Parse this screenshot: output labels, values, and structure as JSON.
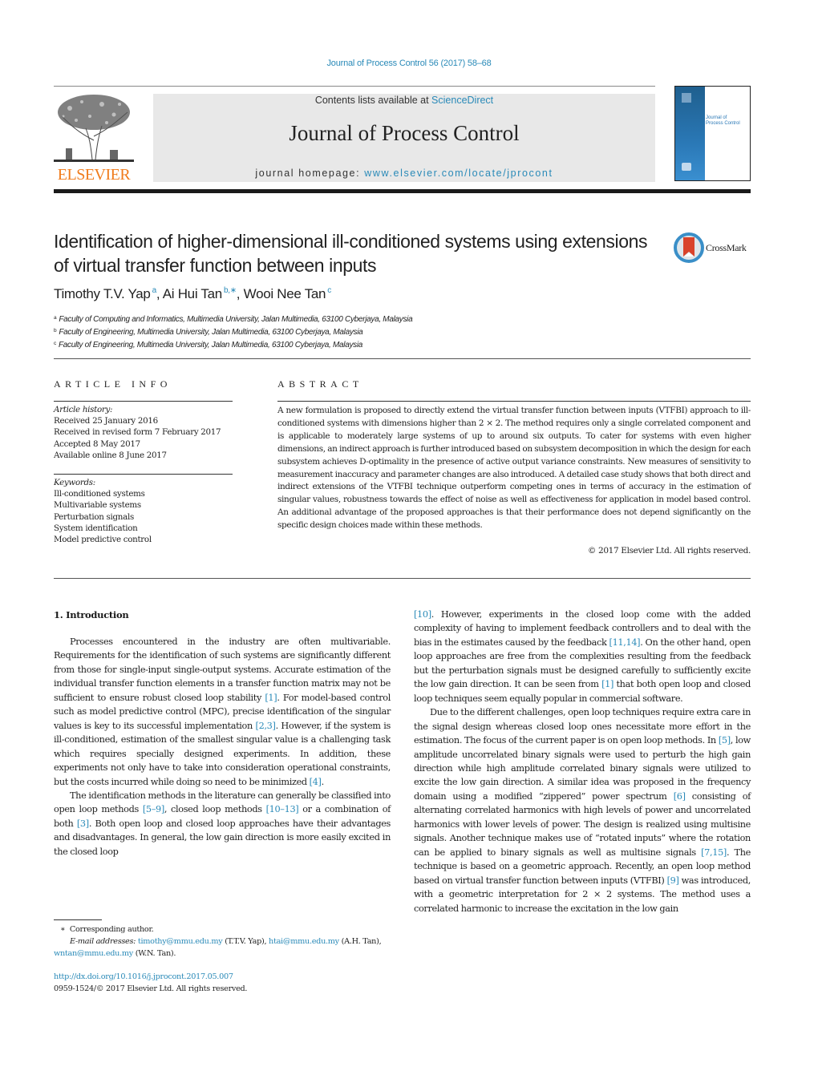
{
  "header": {
    "journal_ref": "Journal of Process Control 56 (2017) 58–68",
    "contents_prefix": "Contents lists available at ",
    "contents_link": "ScienceDirect",
    "journal_title": "Journal of Process Control",
    "homepage_prefix": "journal homepage: ",
    "homepage_link": "www.elsevier.com/locate/jprocont",
    "publisher_logo_text": "ELSEVIER",
    "cover_title_line1": "Journal of",
    "cover_title_line2": "Process Control",
    "colors": {
      "link": "#2a8ab8",
      "elsevier_orange": "#f07c1c",
      "masthead_bg": "#e8e8e8"
    }
  },
  "article": {
    "title": "Identification of higher-dimensional ill-conditioned systems using extensions of virtual transfer function between inputs",
    "crossmark_label": "CrossMark",
    "authors": [
      {
        "name": "Timothy T.V. Yap",
        "sup": "a",
        "sep": ", "
      },
      {
        "name": "Ai Hui Tan",
        "sup": "b,∗",
        "sep": ", "
      },
      {
        "name": "Wooi Nee Tan",
        "sup": "c",
        "sep": ""
      }
    ],
    "affiliations": [
      {
        "key": "a",
        "text": "Faculty of Computing and Informatics, Multimedia University, Jalan Multimedia, 63100 Cyberjaya, Malaysia"
      },
      {
        "key": "b",
        "text": "Faculty of Engineering, Multimedia University, Jalan Multimedia, 63100 Cyberjaya, Malaysia"
      },
      {
        "key": "c",
        "text": "Faculty of Engineering, Multimedia University, Jalan Multimedia, 63100 Cyberjaya, Malaysia"
      }
    ]
  },
  "article_info": {
    "label": "ARTICLE INFO",
    "history_heading": "Article history:",
    "history": [
      "Received 25 January 2016",
      "Received in revised form 7 February 2017",
      "Accepted 8 May 2017",
      "Available online 8 June 2017"
    ],
    "keywords_heading": "Keywords:",
    "keywords": [
      "Ill-conditioned systems",
      "Multivariable systems",
      "Perturbation signals",
      "System identification",
      "Model predictive control"
    ]
  },
  "abstract": {
    "label": "ABSTRACT",
    "text": "A new formulation is proposed to directly extend the virtual transfer function between inputs (VTFBI) approach to ill-conditioned systems with dimensions higher than 2 × 2. The method requires only a single correlated component and is applicable to moderately large systems of up to around six outputs. To cater for systems with even higher dimensions, an indirect approach is further introduced based on subsystem decomposition in which the design for each subsystem achieves D-optimality in the presence of active output variance constraints. New measures of sensitivity to measurement inaccuracy and parameter changes are also introduced. A detailed case study shows that both direct and indirect extensions of the VTFBI technique outperform competing ones in terms of accuracy in the estimation of singular values, robustness towards the effect of noise as well as effectiveness for application in model based control. An additional advantage of the proposed approaches is that their performance does not depend significantly on the specific design choices made within these methods.",
    "copyright": "© 2017 Elsevier Ltd. All rights reserved."
  },
  "body": {
    "intro_heading": "1.  Introduction",
    "paragraphs": [
      {
        "column": "left",
        "indent": true,
        "parts": [
          {
            "t": "Processes encountered in the industry are often multivariable. Requirements for the identification of such systems are significantly different from those for single-input single-output systems. Accurate estimation of the individual transfer function elements in a transfer function matrix may not be sufficient to ensure robust closed loop stability "
          },
          {
            "t": "[1]",
            "ref": true
          },
          {
            "t": ". For model-based control such as model predictive control (MPC), precise identification of the singular values is key to its successful implementation "
          },
          {
            "t": "[2,3]",
            "ref": true
          },
          {
            "t": ". However, if the system is ill-conditioned, estimation of the smallest singular value is a challenging task which requires specially designed experiments. In addition, these experiments not only have to take into consideration operational constraints, but the costs incurred while doing so need to be minimized "
          },
          {
            "t": "[4]",
            "ref": true
          },
          {
            "t": "."
          }
        ]
      },
      {
        "column": "left",
        "indent": true,
        "parts": [
          {
            "t": "The identification methods in the literature can generally be classified into open loop methods "
          },
          {
            "t": "[5–9]",
            "ref": true
          },
          {
            "t": ", closed loop methods "
          },
          {
            "t": "[10–13]",
            "ref": true
          },
          {
            "t": " or a combination of both "
          },
          {
            "t": "[3]",
            "ref": true
          },
          {
            "t": ". Both open loop and closed loop approaches have their advantages and disadvantages. In general, the low gain direction is more easily excited in the closed loop "
          },
          {
            "t": "[10]",
            "ref": true,
            "continues_right": true
          },
          {
            "t": ". However, experiments in the closed loop come with the added complexity of having to implement feedback controllers and to deal with the bias in the estimates caused by the feedback "
          },
          {
            "t": "[11,14]",
            "ref": true
          },
          {
            "t": ". On the other hand, open loop approaches are free from the complexities resulting from the feedback but the perturbation signals must be designed carefully to sufficiently excite the low gain direction. It can be seen from "
          },
          {
            "t": "[1]",
            "ref": true
          },
          {
            "t": " that both open loop and closed loop techniques seem equally popular in commercial software."
          }
        ]
      },
      {
        "column": "right",
        "indent": true,
        "parts": [
          {
            "t": "Due to the different challenges, open loop techniques require extra care in the signal design whereas closed loop ones necessitate more effort in the estimation. The focus of the current paper is on open loop methods. In "
          },
          {
            "t": "[5]",
            "ref": true
          },
          {
            "t": ", low amplitude uncorrelated binary signals were used to perturb the high gain direction while high amplitude correlated binary signals were utilized to excite the low gain direction. A similar idea was proposed in the frequency domain using a modified “zippered” power spectrum "
          },
          {
            "t": "[6]",
            "ref": true
          },
          {
            "t": " consisting of alternating correlated harmonics with high levels of power and uncorrelated harmonics with lower levels of power. The design is realized using multisine signals. Another technique makes use of “rotated inputs” where the rotation can be applied to binary signals as well as multisine signals "
          },
          {
            "t": "[7,15]",
            "ref": true
          },
          {
            "t": ". The technique is based on a geometric approach. Recently, an open loop method based on virtual transfer function between inputs (VTFBI) "
          },
          {
            "t": "[9]",
            "ref": true
          },
          {
            "t": " was introduced, with a geometric interpretation for 2 × 2 systems. The method uses a correlated harmonic to increase the excitation in the low gain"
          }
        ]
      }
    ]
  },
  "footnotes": {
    "corresponding_mark": "∗",
    "corresponding_text": "Corresponding author.",
    "email_label": "E-mail addresses:",
    "emails": [
      {
        "address": "timothy@mmu.edu.my",
        "owner": "(T.T.V. Yap)"
      },
      {
        "address": "htai@mmu.edu.my",
        "owner": "(A.H. Tan)"
      },
      {
        "address": "wntan@mmu.edu.my",
        "owner": "(W.N. Tan)"
      }
    ],
    "doi": "http://dx.doi.org/10.1016/j.jprocont.2017.05.007",
    "issn_line": "0959-1524/© 2017 Elsevier Ltd. All rights reserved."
  }
}
